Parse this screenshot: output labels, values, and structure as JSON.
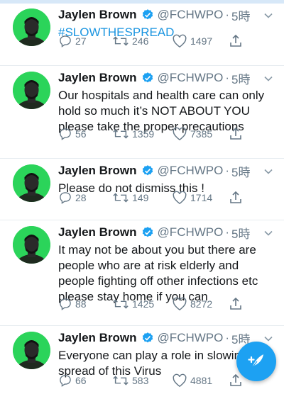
{
  "author": {
    "name": "Jaylen Brown",
    "handle": "@FCHWPO",
    "separator": "·",
    "verified_icon": "verified-badge-icon",
    "avatar_color": "#2bd45a"
  },
  "colors": {
    "brand": "#1da1f2",
    "hashtag": "#1b95e0",
    "secondary": "#657786"
  },
  "tweets": [
    {
      "time": "5時",
      "text": "#SLOWTHESPREAD",
      "replies": "27",
      "retweets": "246",
      "likes": "1497"
    },
    {
      "time": "5時",
      "text": "Our hospitals and health care can only hold so much it’s NOT ABOUT YOU please take the proper precautions",
      "replies": "56",
      "retweets": "1359",
      "likes": "7385"
    },
    {
      "time": "5時",
      "text": "Please do not dismiss this !",
      "replies": "28",
      "retweets": "149",
      "likes": "1714"
    },
    {
      "time": "5時",
      "text": "It may not be about you but there are people who are at risk elderly and people fighting off other infections etc please stay home if you can",
      "replies": "88",
      "retweets": "1425",
      "likes": "8272"
    },
    {
      "time": "5時",
      "text": "Everyone can play a role in slowing the spread of this Virus",
      "replies": "66",
      "retweets": "583",
      "likes": "4881"
    }
  ],
  "compose_button": {
    "icon": "feather-plus-icon"
  }
}
